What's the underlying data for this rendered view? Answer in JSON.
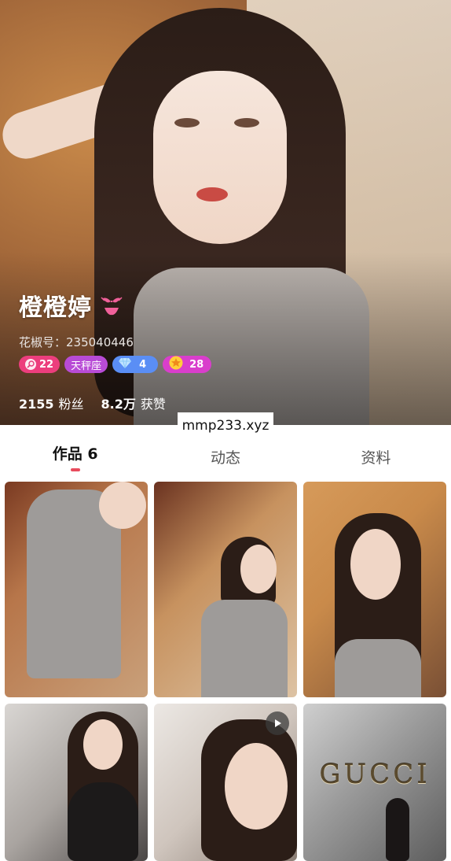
{
  "profile": {
    "name": "橙橙婷",
    "id_text": "花椒号：235040446"
  },
  "badges": [
    {
      "icon": "search-heart-icon",
      "label": "22"
    },
    {
      "icon": "",
      "label": "天秤座"
    },
    {
      "icon": "diamond-icon",
      "label": "4"
    },
    {
      "icon": "star-icon",
      "label": "28"
    }
  ],
  "stats": {
    "fans_num": "2155",
    "fans_label": "粉丝",
    "likes_num": "8.2万",
    "likes_label": "获赞"
  },
  "watermark": "mmp233.xyz",
  "tabs": [
    {
      "label": "作品 6",
      "active": true
    },
    {
      "label": "动态",
      "active": false
    },
    {
      "label": "资料",
      "active": false
    }
  ],
  "grid": {
    "gucci_text": "GUCCI"
  },
  "colors": {
    "accent": "#e84b5d",
    "badge_pink": "#ec3e7d",
    "badge_purple": "#b84bd6",
    "badge_blue": "#5a8ef5",
    "badge_magenta": "#d93ecc"
  }
}
